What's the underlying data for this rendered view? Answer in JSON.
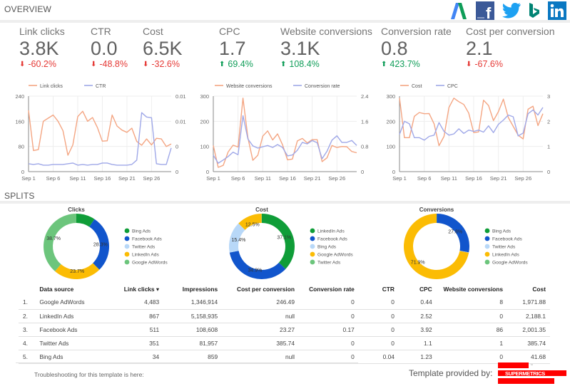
{
  "overview": {
    "title": "OVERVIEW",
    "logos": [
      "google-adwords-logo",
      "facebook-logo",
      "twitter-logo",
      "bing-logo",
      "linkedin-logo"
    ]
  },
  "kpis": [
    {
      "label": "Link clicks",
      "value": "3.8K",
      "delta": "-60.2%",
      "direction": "down"
    },
    {
      "label": "CTR",
      "value": "0.0",
      "delta": "-48.8%",
      "direction": "down"
    },
    {
      "label": "Cost",
      "value": "6.5K",
      "delta": "-32.6%",
      "direction": "down"
    },
    {
      "label": "CPC",
      "value": "1.7",
      "delta": "69.4%",
      "direction": "up"
    },
    {
      "label": "Website conversions",
      "value": "3.1K",
      "delta": "108.4%",
      "direction": "up"
    },
    {
      "label": "Conversion rate",
      "value": "0.8",
      "delta": "423.7%",
      "direction": "up"
    },
    {
      "label": "Cost per conversion",
      "value": "2.1",
      "delta": "-67.6%",
      "direction": "down"
    }
  ],
  "colors": {
    "orange": "#f4a582",
    "purple": "#9fa8e8",
    "down": "#e53935",
    "up": "#0f9d58",
    "green": "#0f9d38",
    "blue": "#1155cc",
    "lightblue": "#b8d8f8",
    "yellow": "#fbbc04",
    "lightgreen": "#6cc57c"
  },
  "splits": {
    "title": "SPLITS"
  },
  "chart_data": [
    {
      "type": "line",
      "title": "",
      "x": [
        "Sep 1",
        "Sep 2",
        "Sep 3",
        "Sep 4",
        "Sep 5",
        "Sep 6",
        "Sep 7",
        "Sep 8",
        "Sep 9",
        "Sep 10",
        "Sep 11",
        "Sep 12",
        "Sep 13",
        "Sep 14",
        "Sep 15",
        "Sep 16",
        "Sep 17",
        "Sep 18",
        "Sep 19",
        "Sep 20",
        "Sep 21",
        "Sep 22",
        "Sep 23",
        "Sep 24",
        "Sep 25",
        "Sep 26",
        "Sep 27",
        "Sep 28",
        "Sep 29",
        "Sep 30"
      ],
      "xticks": [
        "Sep 1",
        "Sep 6",
        "Sep 11",
        "Sep 16",
        "Sep 21",
        "Sep 26"
      ],
      "series": [
        {
          "name": "Link clicks",
          "axis": "left",
          "color": "#f4a582",
          "values": [
            195,
            67,
            70,
            160,
            170,
            180,
            160,
            130,
            52,
            85,
            175,
            192,
            160,
            172,
            140,
            97,
            98,
            180,
            145,
            132,
            125,
            138,
            96,
            84,
            104,
            85,
            106,
            104,
            80,
            88
          ]
        },
        {
          "name": "CTR",
          "axis": "right",
          "color": "#9fa8e8",
          "values": [
            0.0011,
            0.001,
            0.0011,
            0.0009,
            0.0009,
            0.001,
            0.001,
            0.001,
            0.0011,
            0.0012,
            0.0009,
            0.001,
            0.0009,
            0.001,
            0.001,
            0.0012,
            0.0012,
            0.001,
            0.0009,
            0.0009,
            0.0009,
            0.001,
            0.0016,
            0.0082,
            0.0076,
            0.0075,
            0.0011,
            0.001,
            0.001,
            0.0033
          ]
        }
      ],
      "yleft": {
        "ticks": [
          "0",
          "80",
          "160",
          "240"
        ],
        "range": [
          0,
          240
        ]
      },
      "yright": {
        "ticks": [
          "0",
          "0",
          "0.01",
          "0.01"
        ],
        "range": [
          0,
          0.0105
        ]
      }
    },
    {
      "type": "line",
      "title": "",
      "x": [
        "Sep 1",
        "Sep 2",
        "Sep 3",
        "Sep 4",
        "Sep 5",
        "Sep 6",
        "Sep 7",
        "Sep 8",
        "Sep 9",
        "Sep 10",
        "Sep 11",
        "Sep 12",
        "Sep 13",
        "Sep 14",
        "Sep 15",
        "Sep 16",
        "Sep 17",
        "Sep 18",
        "Sep 19",
        "Sep 20",
        "Sep 21",
        "Sep 22",
        "Sep 23",
        "Sep 24",
        "Sep 25",
        "Sep 26",
        "Sep 27",
        "Sep 28",
        "Sep 29",
        "Sep 30"
      ],
      "xticks": [
        "Sep 1",
        "Sep 6",
        "Sep 11",
        "Sep 16",
        "Sep 21",
        "Sep 26"
      ],
      "series": [
        {
          "name": "Website conversions",
          "axis": "left",
          "color": "#f4a582",
          "values": [
            104,
            17,
            25,
            78,
            105,
            98,
            292,
            135,
            45,
            65,
            141,
            162,
            126,
            150,
            107,
            47,
            50,
            122,
            132,
            114,
            127,
            127,
            40,
            55,
            104,
            96,
            100,
            99,
            80,
            75
          ]
        },
        {
          "name": "Conversion rate",
          "axis": "right",
          "color": "#9fa8e8",
          "values": [
            0.52,
            0.27,
            0.37,
            0.48,
            0.62,
            0.54,
            1.78,
            1.04,
            0.82,
            0.75,
            0.79,
            0.83,
            0.77,
            0.86,
            0.77,
            0.5,
            0.53,
            0.68,
            0.93,
            0.88,
            0.99,
            0.92,
            0.41,
            0.65,
            1.0,
            1.14,
            0.93,
            0.93,
            0.99,
            0.83
          ]
        }
      ],
      "yleft": {
        "ticks": [
          "0",
          "100",
          "200",
          "300"
        ],
        "range": [
          0,
          300
        ]
      },
      "yright": {
        "ticks": [
          "0",
          "0.8",
          "1.6",
          "2.4"
        ],
        "range": [
          0,
          2.4
        ]
      }
    },
    {
      "type": "line",
      "title": "",
      "x": [
        "Sep 1",
        "Sep 2",
        "Sep 3",
        "Sep 4",
        "Sep 5",
        "Sep 6",
        "Sep 7",
        "Sep 8",
        "Sep 9",
        "Sep 10",
        "Sep 11",
        "Sep 12",
        "Sep 13",
        "Sep 14",
        "Sep 15",
        "Sep 16",
        "Sep 17",
        "Sep 18",
        "Sep 19",
        "Sep 20",
        "Sep 21",
        "Sep 22",
        "Sep 23",
        "Sep 24",
        "Sep 25",
        "Sep 26",
        "Sep 27",
        "Sep 28",
        "Sep 29",
        "Sep 30"
      ],
      "xticks": [
        "Sep 1",
        "Sep 6",
        "Sep 11",
        "Sep 16",
        "Sep 21",
        "Sep 26"
      ],
      "series": [
        {
          "name": "Cost",
          "axis": "left",
          "color": "#f4a582",
          "values": [
            293,
            135,
            135,
            220,
            235,
            230,
            231,
            190,
            103,
            140,
            255,
            292,
            278,
            267,
            233,
            155,
            158,
            284,
            263,
            203,
            238,
            288,
            215,
            180,
            145,
            130,
            248,
            260,
            183,
            230
          ]
        },
        {
          "name": "CPC",
          "axis": "right",
          "color": "#9fa8e8",
          "values": [
            1.48,
            2.0,
            1.9,
            1.35,
            1.35,
            1.25,
            1.4,
            1.45,
            1.95,
            1.6,
            1.45,
            1.5,
            1.7,
            1.52,
            1.65,
            1.6,
            1.65,
            1.57,
            1.82,
            1.55,
            1.88,
            2.05,
            2.25,
            2.18,
            1.42,
            1.53,
            2.3,
            2.45,
            2.25,
            2.55
          ]
        }
      ],
      "yleft": {
        "ticks": [
          "0",
          "100",
          "200",
          "300"
        ],
        "range": [
          0,
          300
        ]
      },
      "yright": {
        "ticks": [
          "0",
          "1",
          "2",
          "3"
        ],
        "range": [
          0,
          3
        ]
      }
    },
    {
      "type": "pie",
      "title": "Clicks",
      "slices": [
        {
          "name": "Bing Ads",
          "value": 9.3,
          "color": "#0f9d38",
          "label": ""
        },
        {
          "name": "Facebook Ads",
          "value": 28.3,
          "color": "#1155cc",
          "label": "28.3%"
        },
        {
          "name": "Twitter Ads",
          "value": 0,
          "color": "#b8d8f8",
          "label": ""
        },
        {
          "name": "LinkedIn Ads",
          "value": 23.7,
          "color": "#fbbc04",
          "label": "23.7%"
        },
        {
          "name": "Google AdWords",
          "value": 38.7,
          "color": "#6cc57c",
          "label": "38.7%"
        }
      ],
      "legend": [
        "Bing Ads",
        "Facebook Ads",
        "Twitter Ads",
        "LinkedIn Ads",
        "Google AdWords"
      ],
      "legend_colors": [
        "#0f9d38",
        "#1155cc",
        "#b8d8f8",
        "#fbbc04",
        "#6cc57c"
      ]
    },
    {
      "type": "pie",
      "title": "Cost",
      "slices": [
        {
          "name": "LinkedIn Ads",
          "value": 37.1,
          "color": "#0f9d38",
          "label": "37.1%"
        },
        {
          "name": "Facebook Ads",
          "value": 34.9,
          "color": "#1155cc",
          "label": "34.9%"
        },
        {
          "name": "Bing Ads",
          "value": 15.4,
          "color": "#b8d8f8",
          "label": "15.4%"
        },
        {
          "name": "Google AdWords",
          "value": 12.5,
          "color": "#fbbc04",
          "label": "12.5%"
        },
        {
          "name": "Twitter Ads",
          "value": 0.1,
          "color": "#6cc57c",
          "label": ""
        }
      ],
      "legend": [
        "LinkedIn Ads",
        "Facebook Ads",
        "Bing Ads",
        "Google AdWords",
        "Twitter Ads"
      ],
      "legend_colors": [
        "#0f9d38",
        "#1155cc",
        "#b8d8f8",
        "#fbbc04",
        "#6cc57c"
      ]
    },
    {
      "type": "pie",
      "title": "Conversions",
      "slices": [
        {
          "name": "Bing Ads",
          "value": 0.1,
          "color": "#0f9d38",
          "label": ""
        },
        {
          "name": "Facebook Ads",
          "value": 27.8,
          "color": "#1155cc",
          "label": "27.8%"
        },
        {
          "name": "Twitter Ads",
          "value": 0.2,
          "color": "#b8d8f8",
          "label": ""
        },
        {
          "name": "LinkedIn Ads",
          "value": 71.9,
          "color": "#fbbc04",
          "label": "71.9%"
        },
        {
          "name": "Google AdWords",
          "value": 0,
          "color": "#6cc57c",
          "label": ""
        }
      ],
      "legend": [
        "Bing Ads",
        "Facebook Ads",
        "Twitter Ads",
        "LinkedIn Ads",
        "Google AdWords"
      ],
      "legend_colors": [
        "#0f9d38",
        "#1155cc",
        "#b8d8f8",
        "#fbbc04",
        "#6cc57c"
      ]
    }
  ],
  "table": {
    "columns": [
      "",
      "Data source",
      "Link clicks ▾",
      "Impressions",
      "Cost per conversion",
      "Conversion rate",
      "CTR",
      "CPC",
      "Website conversions",
      "Cost"
    ],
    "rows": [
      [
        "1.",
        "Google AdWords",
        "4,483",
        "1,346,914",
        "246.49",
        "0",
        "0",
        "0.44",
        "8",
        "1,971.88"
      ],
      [
        "2.",
        "LinkedIn Ads",
        "867",
        "5,158,935",
        "null",
        "0",
        "0",
        "2.52",
        "0",
        "2,188.1"
      ],
      [
        "3.",
        "Facebook Ads",
        "511",
        "108,608",
        "23.27",
        "0.17",
        "0",
        "3.92",
        "86",
        "2,001.35"
      ],
      [
        "4.",
        "Twitter Ads",
        "351",
        "81,957",
        "385.74",
        "0",
        "0",
        "1.1",
        "1",
        "385.74"
      ],
      [
        "5.",
        "Bing Ads",
        "34",
        "859",
        "null",
        "0",
        "0.04",
        "1.23",
        "0",
        "41.68"
      ]
    ]
  },
  "footer": {
    "troubleshooting": "Troubleshooting for this template is here:",
    "provided_by": "Template provided by:",
    "brand": "SUPERMETRICS",
    "tm": "™"
  }
}
